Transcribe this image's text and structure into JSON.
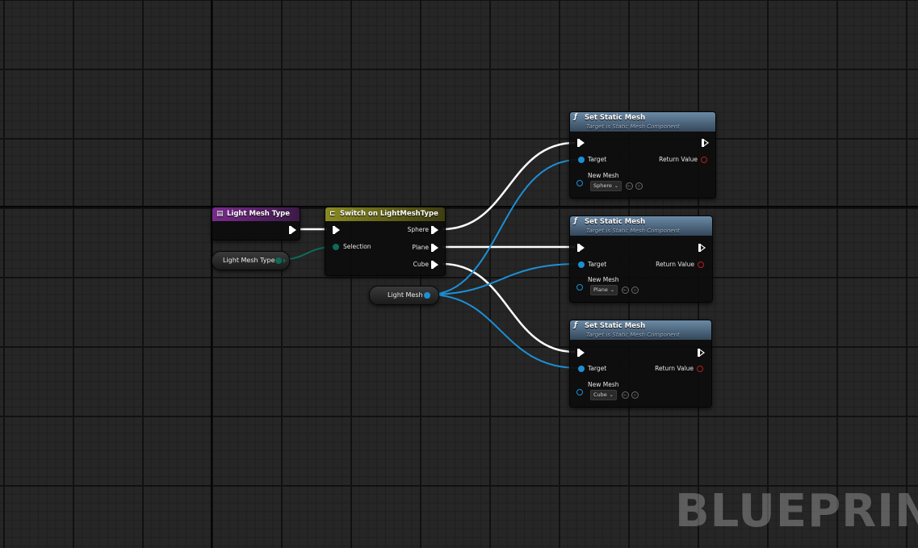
{
  "watermark": "BLUEPRINT",
  "colors": {
    "exec_wire": "#ffffff",
    "object_wire": "#1d8fd4",
    "enum_wire": "#0e6b58",
    "function_header": "#5c7a94",
    "switch_header": "#8a8a22",
    "enum_header": "#7a2a8e",
    "return_pin": "#b41e1e"
  },
  "nodes": {
    "light_mesh_type_getter": {
      "title": "Light Mesh Type",
      "icon": "enum-icon"
    },
    "light_mesh_type_var": {
      "label": "Light Mesh Type"
    },
    "switch": {
      "title": "Switch on LightMeshType",
      "icon": "switch-icon",
      "selection_label": "Selection",
      "outputs": [
        "Sphere",
        "Plane",
        "Cube"
      ]
    },
    "light_mesh_var": {
      "label": "Light Mesh"
    },
    "set_static_mesh_1": {
      "title": "Set Static Mesh",
      "subtitle": "Target is Static Mesh Component",
      "target_label": "Target",
      "return_label": "Return Value",
      "new_mesh_label": "New Mesh",
      "mesh_value": "Sphere"
    },
    "set_static_mesh_2": {
      "title": "Set Static Mesh",
      "subtitle": "Target is Static Mesh Component",
      "target_label": "Target",
      "return_label": "Return Value",
      "new_mesh_label": "New Mesh",
      "mesh_value": "Plane"
    },
    "set_static_mesh_3": {
      "title": "Set Static Mesh",
      "subtitle": "Target is Static Mesh Component",
      "target_label": "Target",
      "return_label": "Return Value",
      "new_mesh_label": "New Mesh",
      "mesh_value": "Cube"
    }
  }
}
